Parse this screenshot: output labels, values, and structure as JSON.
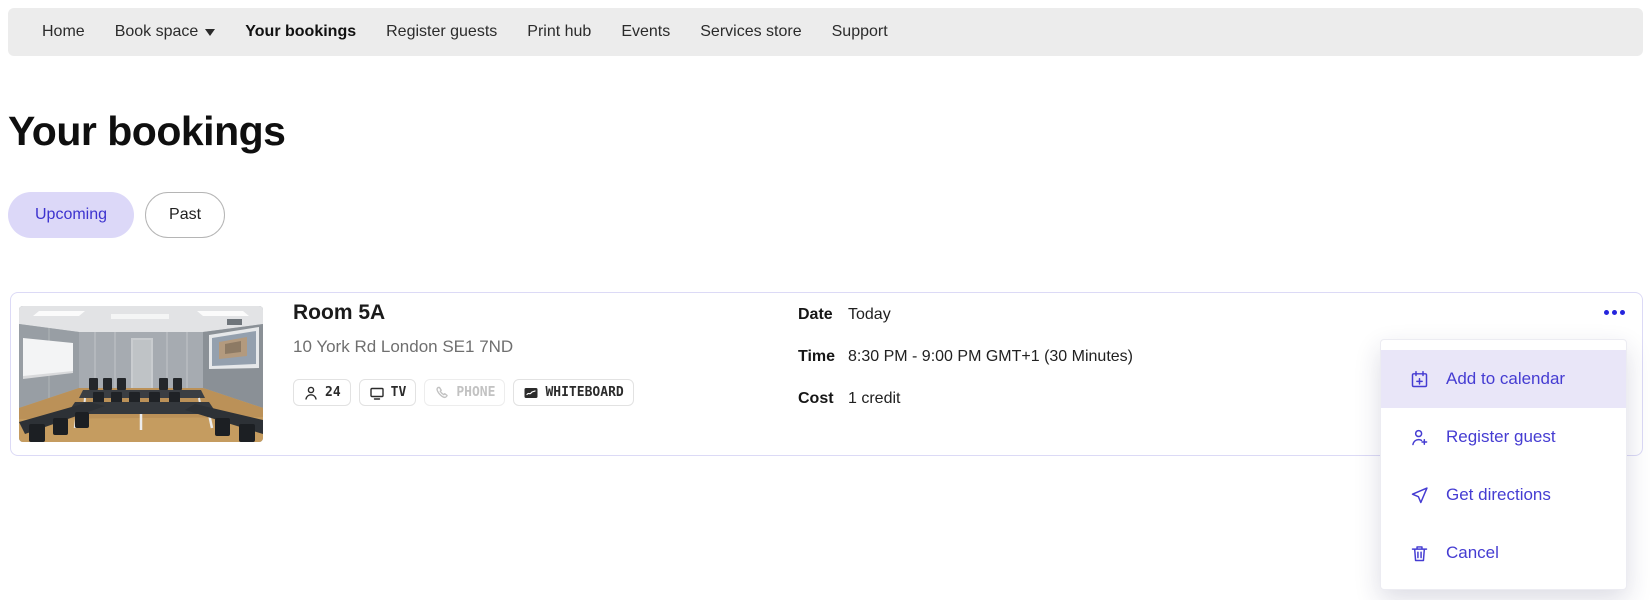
{
  "colors": {
    "accent": "#3d33cf",
    "kebab_dots": "#2525dd",
    "pill_active_bg": "#dcd8f8",
    "menu_highlight_bg": "#e9e6f8",
    "navbar_bg": "#ececec",
    "card_border": "#dcdaf6"
  },
  "nav": {
    "items": [
      {
        "label": "Home"
      },
      {
        "label": "Book space",
        "dropdown": true
      },
      {
        "label": "Your bookings",
        "active": true
      },
      {
        "label": "Register guests"
      },
      {
        "label": "Print hub"
      },
      {
        "label": "Events"
      },
      {
        "label": "Services store"
      },
      {
        "label": "Support"
      }
    ]
  },
  "page": {
    "title": "Your bookings"
  },
  "filters": {
    "upcoming_label": "Upcoming",
    "past_label": "Past"
  },
  "booking": {
    "room_name": "Room 5A",
    "address": "10 York Rd London SE1 7ND",
    "amenities": [
      {
        "icon": "person-icon",
        "label": "24"
      },
      {
        "icon": "tv-icon",
        "label": "TV"
      },
      {
        "icon": "phone-icon",
        "label": "PHONE",
        "disabled": true
      },
      {
        "icon": "whiteboard-icon",
        "label": "WHITEBOARD"
      }
    ],
    "details": [
      {
        "label": "Date",
        "value": "Today"
      },
      {
        "label": "Time",
        "value": "8:30 PM - 9:00 PM GMT+1 (30 Minutes)"
      },
      {
        "label": "Cost",
        "value": "1 credit"
      }
    ]
  },
  "context_menu": {
    "items": [
      {
        "icon": "calendar-plus-icon",
        "label": "Add to calendar",
        "highlighted": true
      },
      {
        "icon": "person-plus-icon",
        "label": "Register guest"
      },
      {
        "icon": "navigation-icon",
        "label": "Get directions"
      },
      {
        "icon": "trash-icon",
        "label": "Cancel"
      }
    ]
  }
}
